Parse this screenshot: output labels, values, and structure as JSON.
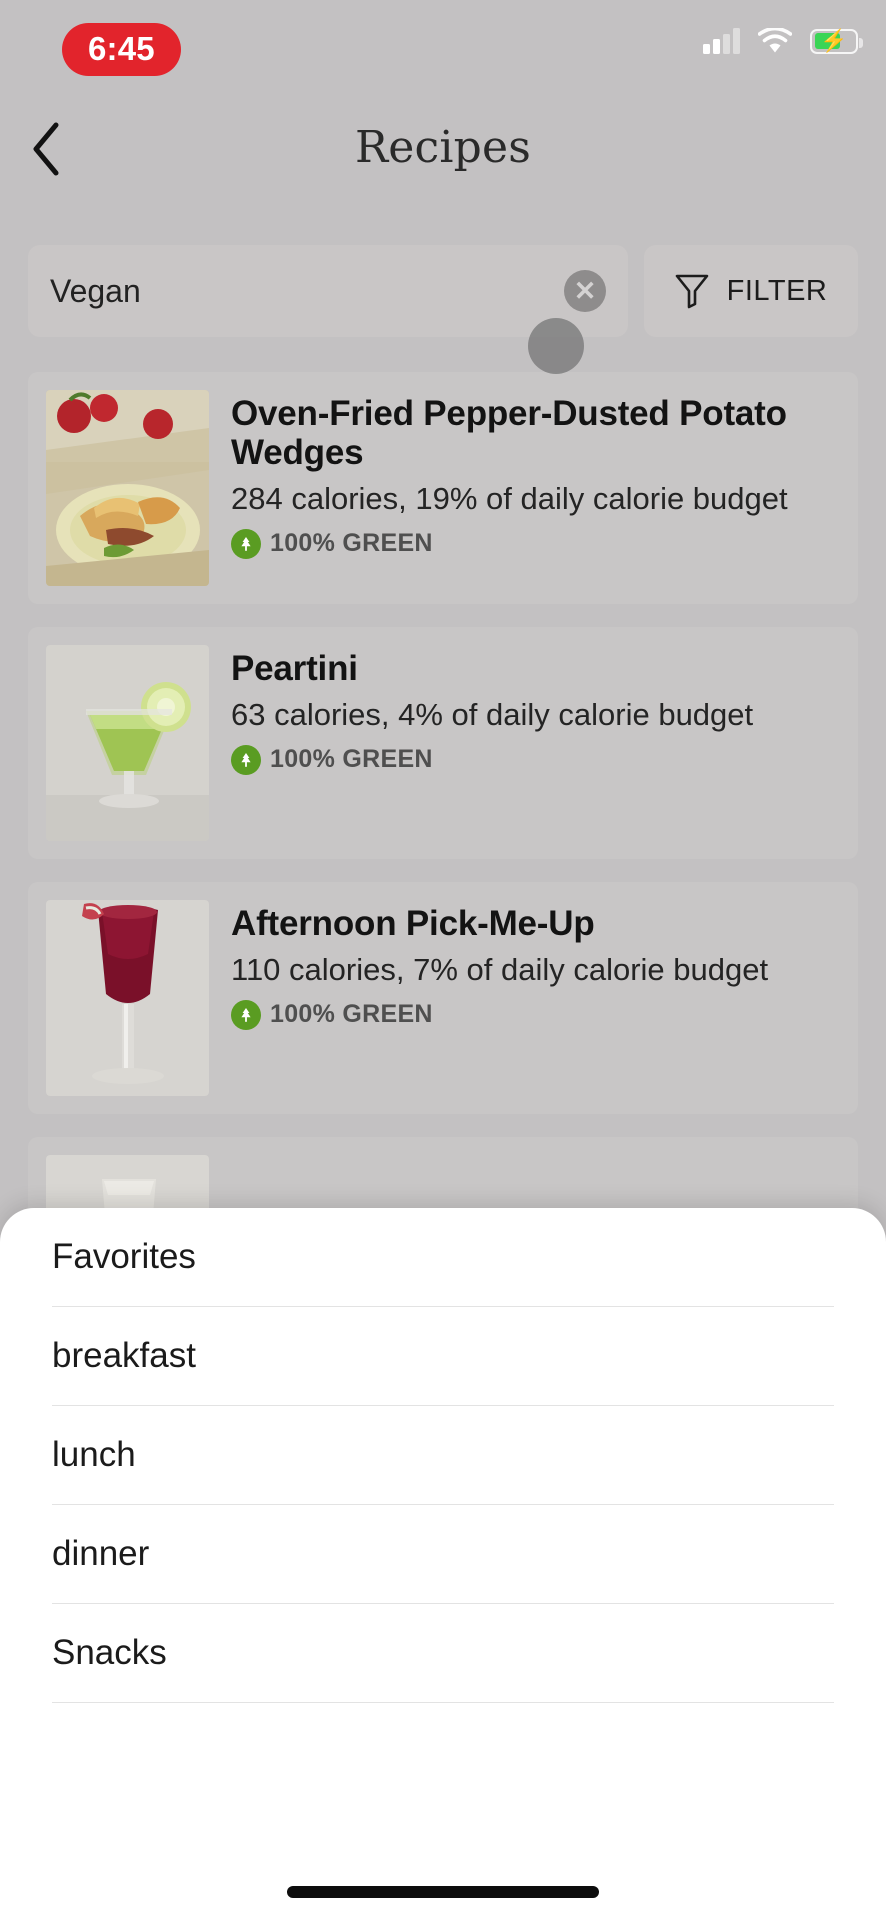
{
  "status_bar": {
    "time": "6:45",
    "time_pill_color": "#e2242c",
    "icons": [
      "signal-icon",
      "wifi-icon",
      "battery-charging-icon"
    ],
    "battery_charging": true
  },
  "header": {
    "back_icon": "chevron-left-icon",
    "title": "Recipes"
  },
  "search": {
    "value": "Vegan",
    "placeholder": "Search",
    "clear_icon": "close-circle-icon",
    "filter_label": "FILTER",
    "filter_icon": "funnel-icon"
  },
  "recipes": [
    {
      "title": "Oven-Fried Pepper-Dusted Potato Wedges",
      "calories": "284 calories, 19% of daily calorie budget",
      "badge": "100% GREEN",
      "badge_icon": "tree-icon",
      "badge_color": "#5a9c22",
      "image": "potato-wedges-photo"
    },
    {
      "title": "Peartini",
      "calories": "63 calories, 4% of daily calorie budget",
      "badge": "100% GREEN",
      "badge_icon": "tree-icon",
      "badge_color": "#5a9c22",
      "image": "peartini-cocktail-photo"
    },
    {
      "title": "Afternoon Pick-Me-Up",
      "calories": "110 calories, 7% of daily calorie budget",
      "badge": "100% GREEN",
      "badge_icon": "tree-icon",
      "badge_color": "#5a9c22",
      "image": "red-drink-photo"
    }
  ],
  "bottom_sheet": {
    "items": [
      {
        "label": "Favorites"
      },
      {
        "label": "breakfast"
      },
      {
        "label": "lunch"
      },
      {
        "label": "dinner"
      },
      {
        "label": "Snacks"
      }
    ]
  }
}
